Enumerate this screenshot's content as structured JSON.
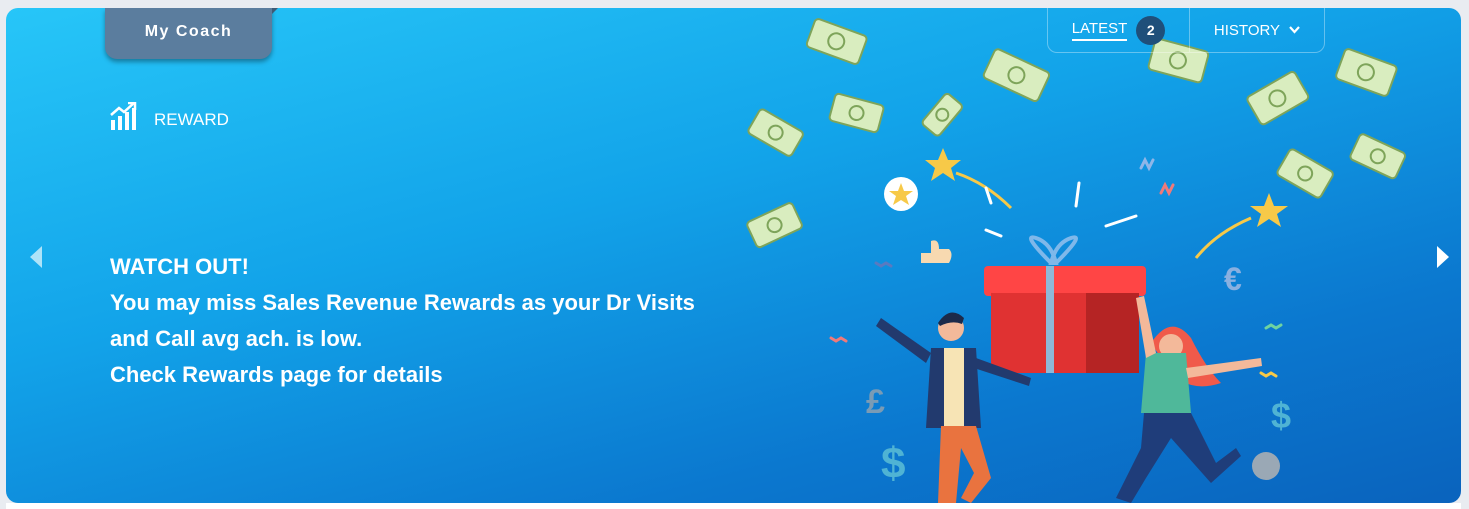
{
  "coach_tab": {
    "label": "My Coach"
  },
  "section": {
    "label": "REWARD",
    "icon": "growth-chart-icon"
  },
  "message": {
    "title": "WATCH OUT!",
    "lines": [
      "You may miss Sales Revenue Rewards as your Dr Visits",
      "and Call avg ach. is low.",
      "Check Rewards page for details"
    ]
  },
  "tabs": {
    "latest": {
      "label": "LATEST",
      "count": "2"
    },
    "history": {
      "label": "HISTORY",
      "icon": "chevron-down-icon"
    }
  },
  "nav": {
    "prev_icon": "arrow-left-icon",
    "next_icon": "arrow-right-icon"
  },
  "colors": {
    "banner_top": "#27c6f8",
    "banner_bottom": "#0a63bd",
    "coach_tab": "#5b7d9e",
    "badge": "#1f4f7a",
    "gift": "#e83a3a"
  }
}
